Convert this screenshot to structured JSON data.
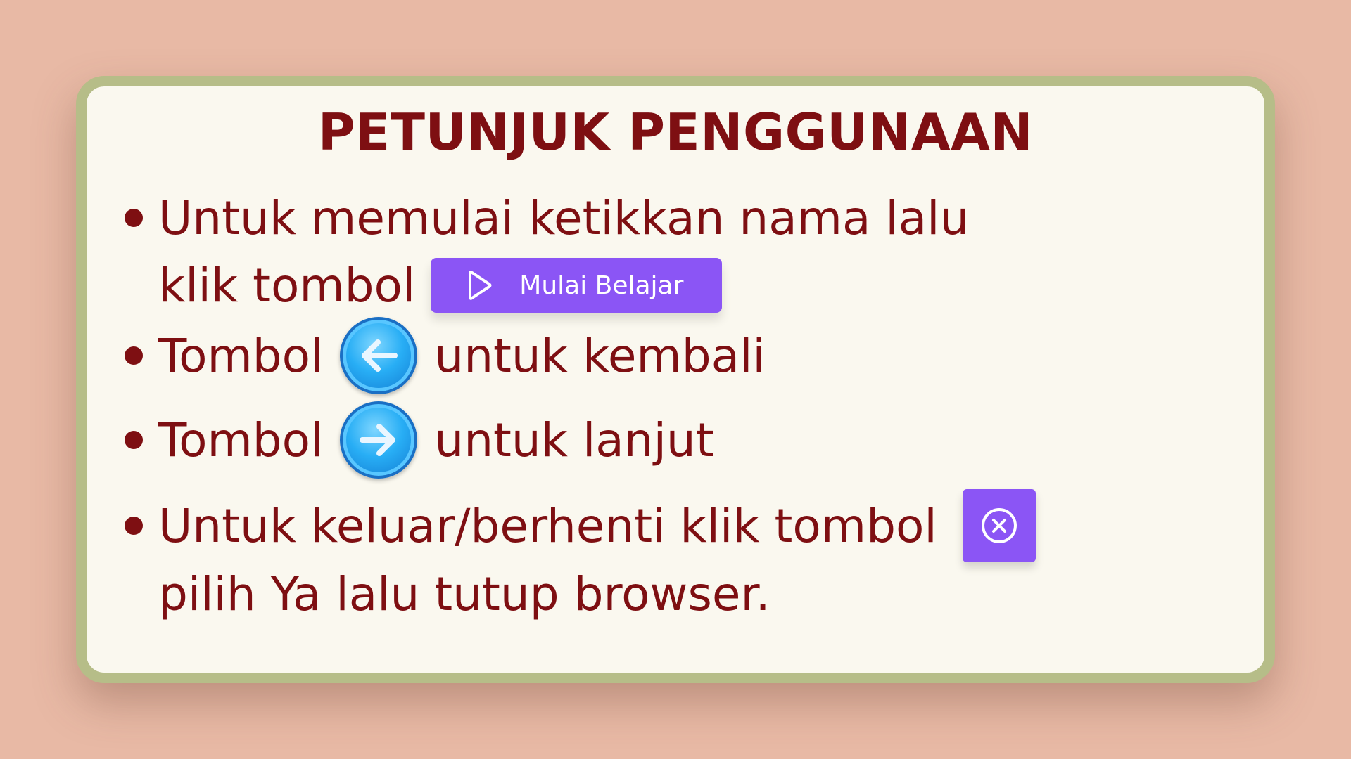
{
  "title": "PETUNJUK PENGGUNAAN",
  "instructions": {
    "item1_line1": "Untuk memulai ketikkan nama lalu",
    "item1_line2": "klik tombol",
    "start_button_label": "Mulai Belajar",
    "item2_before": "Tombol",
    "item2_after": "untuk kembali",
    "item3_before": "Tombol",
    "item3_after": "untuk lanjut",
    "item4_line1": "Untuk keluar/berhenti klik tombol",
    "item4_line2": "pilih Ya lalu tutup browser."
  },
  "icons": {
    "start": "play-icon",
    "back": "arrow-left-icon",
    "next": "arrow-right-icon",
    "exit": "close-circle-icon"
  },
  "colors": {
    "background": "#e8b9a5",
    "card": "#faf8ef",
    "card_border": "#b6bd88",
    "text": "#7e0f12",
    "button_purple": "#8b55f5",
    "button_blue": "#28aef5"
  }
}
